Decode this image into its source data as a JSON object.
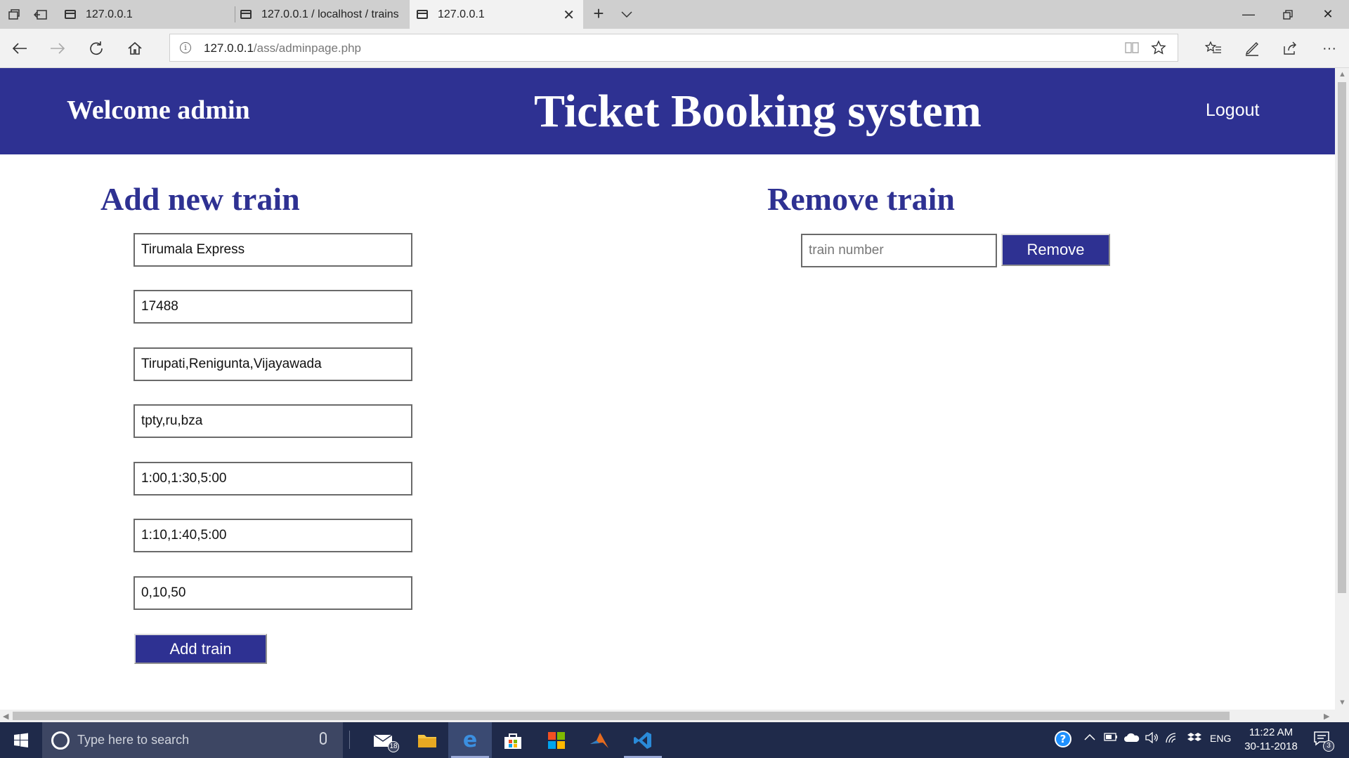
{
  "browser": {
    "tabs": [
      {
        "label": "127.0.0.1",
        "active": false
      },
      {
        "label": "127.0.0.1 / localhost / trains",
        "active": false
      },
      {
        "label": "127.0.0.1",
        "active": true
      }
    ],
    "url_host": "127.0.0.1",
    "url_path": "/ass/adminpage.php"
  },
  "header": {
    "welcome": "Welcome admin",
    "title": "Ticket Booking system",
    "logout": "Logout",
    "background_color": "#2e3192"
  },
  "add_section": {
    "title": "Add new train",
    "fields": [
      {
        "value": "Tirumala Express"
      },
      {
        "value": "17488"
      },
      {
        "value": "Tirupati,Renigunta,Vijayawada"
      },
      {
        "value": "tpty,ru,bza"
      },
      {
        "value": "1:00,1:30,5:00"
      },
      {
        "value": "1:10,1:40,5:00"
      },
      {
        "value": "0,10,50"
      }
    ],
    "button": "Add train"
  },
  "remove_section": {
    "title": "Remove train",
    "placeholder": "train number",
    "button": "Remove"
  },
  "taskbar": {
    "search_placeholder": "Type here to search",
    "mail_badge": "18",
    "language": "ENG",
    "time": "11:22 AM",
    "date": "30-11-2018",
    "notification_badge": "3"
  }
}
